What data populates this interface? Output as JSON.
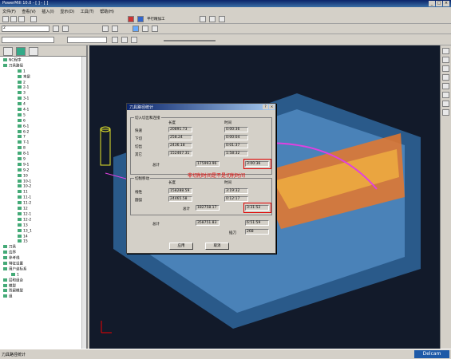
{
  "window": {
    "title": "PowerMill 10.0 - [ ] - [ ]",
    "controls": [
      "_",
      "□",
      "×"
    ]
  },
  "menu": [
    "文件(F)",
    "查看(V)",
    "插入(I)",
    "显示(D)",
    "工具(T)",
    "帮助(H)"
  ],
  "toolbar": {
    "combo_value": "2",
    "machining_label": "平行精加工"
  },
  "tree": {
    "items": [
      "NC程序",
      "刀具路径",
      "1",
      "本是",
      "2",
      "2-1",
      "3",
      "3-1",
      "4",
      "4-1",
      "5",
      "6",
      "6-1",
      "6-2",
      "7",
      "7-1",
      "8",
      "8-1",
      "9",
      "9-1",
      "9-2",
      "10",
      "10-1",
      "10-2",
      "11",
      "11-1",
      "11-2",
      "12",
      "12-1",
      "12-2",
      "13",
      "13_1",
      "14",
      "15",
      "刀具",
      "边界",
      "参考线",
      "特征设置",
      "用户坐标系",
      "1",
      "层和组合",
      "模型",
      "残留模型",
      "组"
    ]
  },
  "dialog": {
    "title": "刀具路径统计",
    "cut_group": "切入切出和连接",
    "length_header": "长度",
    "time_header": "时间",
    "rows1": [
      {
        "label": "快速",
        "length": "20891.73",
        "time": "0:00:36"
      },
      {
        "label": "下切",
        "length": "258.24",
        "time": "0:00:04"
      },
      {
        "label": "切出",
        "length": "2436.18",
        "time": "0:01:37"
      },
      {
        "label": "其它",
        "length": "152467.31",
        "time": "1:58:32"
      }
    ],
    "total1_label": "总计",
    "total1_length": "175993.96",
    "total1_time": "3:00:36",
    "cutting_group": "切削移动",
    "rows2": [
      {
        "label": "线性",
        "length": "158288.59",
        "time": "3:19:32"
      },
      {
        "label": "圆弧",
        "length": "24465.58",
        "time": "0:12:17"
      }
    ],
    "total2_label": "总计",
    "total2_length": "182758.17",
    "total2_time": "3:31:52",
    "grand_total_label": "总计",
    "grand_total_length": "358751.83",
    "grand_total_time": "6:51:59",
    "count_label": "插刀",
    "count_value": "268",
    "ok_button": "应用",
    "cancel_button": "取消"
  },
  "annotation": "非切削时间是不是切削时间",
  "status": {
    "text": "刀具路径统计",
    "brand": "Delcam"
  },
  "colors": {
    "accent": "#e00000",
    "title": "#0a246a",
    "viewport": "#121a2a"
  }
}
